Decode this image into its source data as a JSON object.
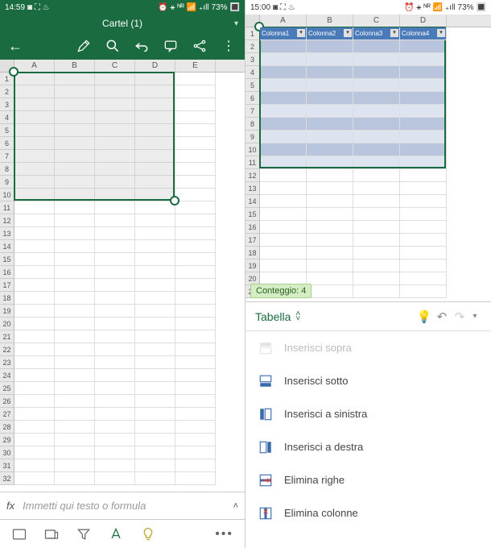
{
  "left": {
    "status": {
      "time": "14:59",
      "icons_left": "◙ ⛶ ♨",
      "icons_right": "⏰ ⚹ ᴺᴿ 📶 ₊ıll",
      "battery": "73%",
      "batt_icon": "🔳"
    },
    "title": "Cartel (1)",
    "columns": [
      "A",
      "B",
      "C",
      "D",
      "E"
    ],
    "rows_count": 32,
    "selection": {
      "from_col": 0,
      "to_col": 3,
      "from_row": 1,
      "to_row": 10
    },
    "formula_placeholder": "Immetti qui testo o formula",
    "fx_label": "fx"
  },
  "right": {
    "status": {
      "time": "15:00",
      "icons_left": "◙ ⛶ ♨",
      "icons_right": "⏰ ⚹ ᴺᴿ 📶 ₊ıll",
      "battery": "73%",
      "batt_icon": "🔳"
    },
    "columns": [
      "A",
      "B",
      "C",
      "D"
    ],
    "table_headers": [
      "Colonna1",
      "Colonna2",
      "Colonna3",
      "Colonna4"
    ],
    "rows_count": 21,
    "table_rows": 11,
    "count_label": "Conteggio: 4",
    "ribbon_title": "Tabella",
    "menu": [
      {
        "label": "Inserisci sopra",
        "icon": "insert-above",
        "disabled": true
      },
      {
        "label": "Inserisci sotto",
        "icon": "insert-below",
        "disabled": false
      },
      {
        "label": "Inserisci a sinistra",
        "icon": "insert-left",
        "disabled": false
      },
      {
        "label": "Inserisci a destra",
        "icon": "insert-right",
        "disabled": false
      },
      {
        "label": "Elimina righe",
        "icon": "delete-rows",
        "disabled": false
      },
      {
        "label": "Elimina colonne",
        "icon": "delete-cols",
        "disabled": false
      }
    ]
  }
}
